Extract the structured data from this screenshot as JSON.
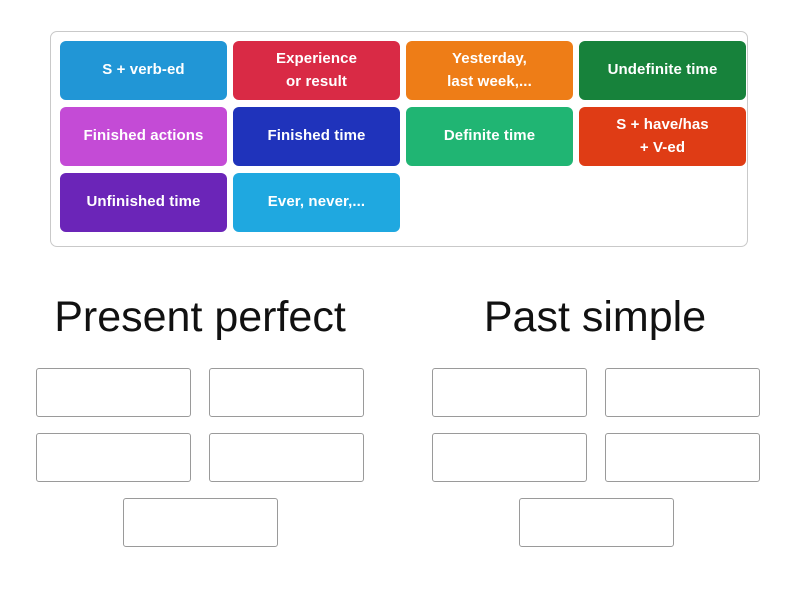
{
  "activity": {
    "type": "group-sort",
    "tray": {
      "tiles": [
        {
          "label": "S + verb-ed",
          "color": "#2196d6"
        },
        {
          "label": "Experience\nor result",
          "color": "#d92a45"
        },
        {
          "label": "Yesterday,\nlast week,...",
          "color": "#ee7d17"
        },
        {
          "label": "Undefinite time",
          "color": "#17823b"
        },
        {
          "label": "Finished actions",
          "color": "#c44bd6"
        },
        {
          "label": "Finished time",
          "color": "#1f33bb"
        },
        {
          "label": "Definite time",
          "color": "#20b573"
        },
        {
          "label": "S + have/has\n+ V-ed",
          "color": "#df3c15"
        },
        {
          "label": "Unfinished time",
          "color": "#6b25b8"
        },
        {
          "label": "Ever, never,...",
          "color": "#1fa8e0"
        }
      ]
    },
    "groups": [
      {
        "title": "Present perfect",
        "slots": [
          "",
          "",
          "",
          "",
          ""
        ]
      },
      {
        "title": "Past simple",
        "slots": [
          "",
          "",
          "",
          "",
          ""
        ]
      }
    ]
  }
}
